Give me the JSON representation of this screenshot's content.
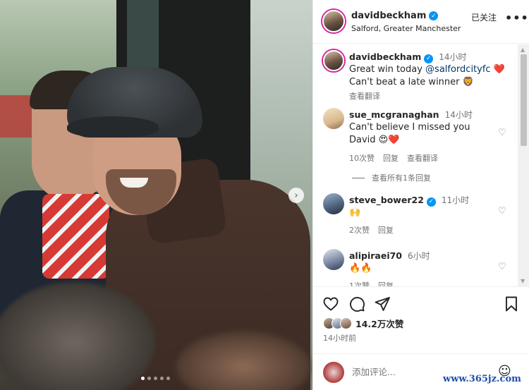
{
  "post": {
    "username": "davidbeckham",
    "location": "Salford, Greater Manchester",
    "follow_status": "已关注",
    "more": "•••"
  },
  "carousel": {
    "next": "›",
    "dots": 5,
    "active_dot": 0
  },
  "comments": [
    {
      "username": "davidbeckham",
      "verified": true,
      "time": "14小时",
      "text_prefix": "Great win today ",
      "mention": "@salfordcityfc",
      "text_suffix": " ❤️",
      "text_line2": "Can't beat a late winner 🦁",
      "translate": "查看翻译"
    },
    {
      "username": "sue_mcgranaghan",
      "verified": false,
      "time": "14小时",
      "text_line1": "Can't believe I missed you",
      "text_line2": "David 😍❤️",
      "likes": "10次赞",
      "reply": "回复",
      "translate": "查看翻译",
      "view_replies": "查看所有1条回复"
    },
    {
      "username": "steve_bower22",
      "verified": true,
      "time": "11小时",
      "text_line1": "🙌",
      "likes": "2次赞",
      "reply": "回复"
    },
    {
      "username": "alipiraei70",
      "verified": false,
      "time": "6小时",
      "text_line1": "🔥🔥",
      "likes": "1次赞",
      "reply": "回复"
    }
  ],
  "actions": {
    "likes": "14.2万次赞",
    "post_time": "14小时前",
    "add_comment_placeholder": "添加评论...",
    "emoji": "☺"
  },
  "icons": {
    "heart": "heart-icon",
    "comment": "comment-icon",
    "share": "share-icon",
    "bookmark": "bookmark-icon",
    "verified": "verified-icon"
  },
  "colors": {
    "verified": "#0095f6",
    "mention": "#00376b",
    "story_ring": "#d6249f"
  },
  "watermark": "www.365jz.com"
}
